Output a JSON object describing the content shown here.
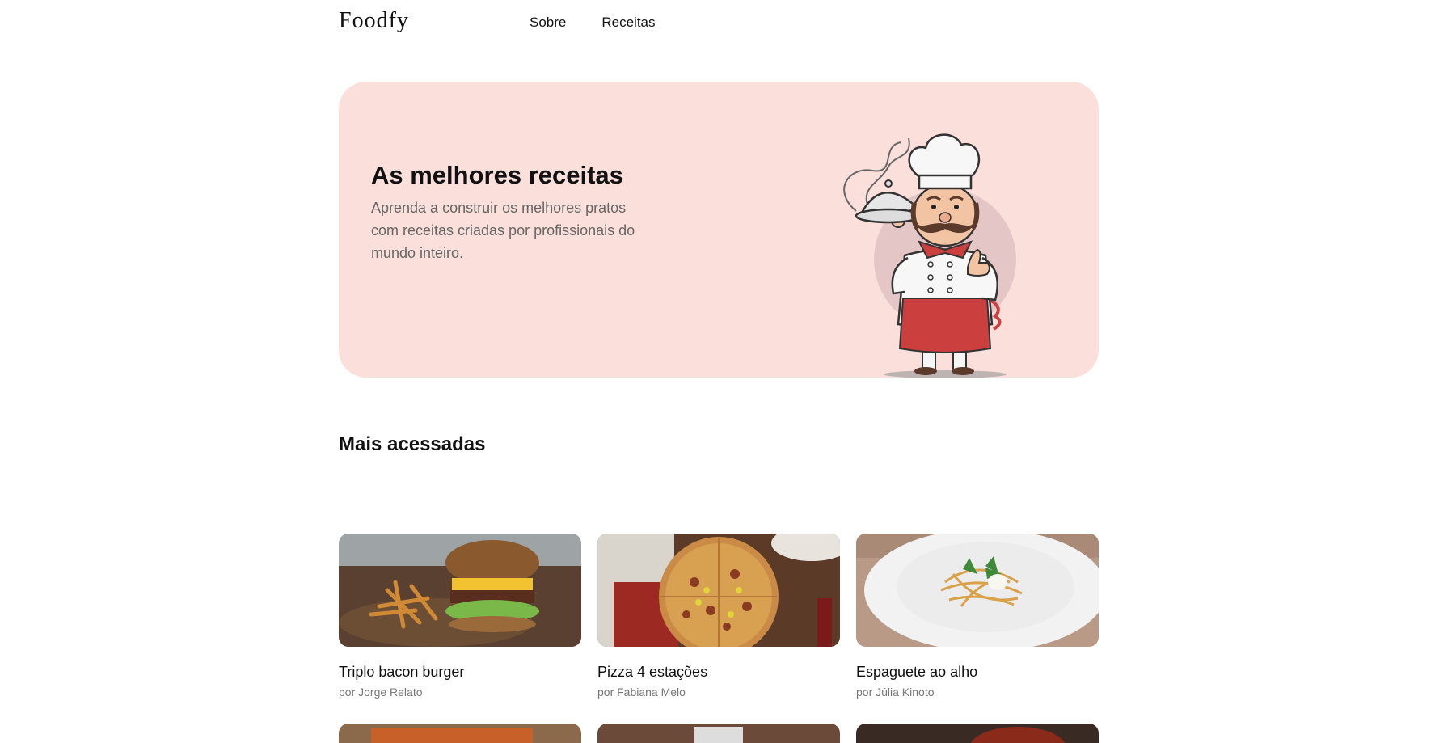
{
  "header": {
    "logo": "Foodfy",
    "nav": [
      {
        "label": "Sobre"
      },
      {
        "label": "Receitas"
      }
    ]
  },
  "hero": {
    "title": "As melhores receitas",
    "text": "Aprenda a construir os melhores pratos com receitas criadas por profissionais do mundo inteiro."
  },
  "section": {
    "title": "Mais acessadas"
  },
  "recipes": [
    {
      "name": "Triplo bacon burger",
      "author": "por Jorge Relato"
    },
    {
      "name": "Pizza 4 estações",
      "author": "por Fabiana Melo"
    },
    {
      "name": "Espaguete ao alho",
      "author": "por Júlia Kinoto"
    }
  ],
  "colors": {
    "hero_bg": "#fbdfdb",
    "text": "#111111",
    "muted": "#666666"
  }
}
